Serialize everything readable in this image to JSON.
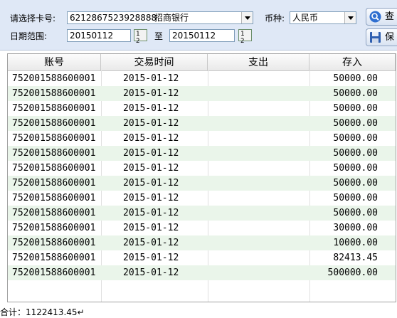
{
  "filter": {
    "card_label": "请选择卡号:",
    "card_number": "6212867523928888",
    "bank_name": "招商银行",
    "currency_label": "币种:",
    "currency_value": "人民币",
    "date_label": "日期范围:",
    "date_from": "20150112",
    "date_to_label": "至",
    "date_to": "20150112",
    "calendar_icon_text": "1 2"
  },
  "toolbar": {
    "query_label": "查",
    "save_label": "保"
  },
  "table": {
    "columns": [
      "账号",
      "交易时间",
      "支出",
      "存入"
    ],
    "rows": [
      {
        "account": "752001588600001",
        "time": "2015-01-12",
        "out": "",
        "in": "50000.00"
      },
      {
        "account": "752001588600001",
        "time": "2015-01-12",
        "out": "",
        "in": "50000.00"
      },
      {
        "account": "752001588600001",
        "time": "2015-01-12",
        "out": "",
        "in": "50000.00"
      },
      {
        "account": "752001588600001",
        "time": "2015-01-12",
        "out": "",
        "in": "50000.00"
      },
      {
        "account": "752001588600001",
        "time": "2015-01-12",
        "out": "",
        "in": "50000.00"
      },
      {
        "account": "752001588600001",
        "time": "2015-01-12",
        "out": "",
        "in": "50000.00"
      },
      {
        "account": "752001588600001",
        "time": "2015-01-12",
        "out": "",
        "in": "50000.00"
      },
      {
        "account": "752001588600001",
        "time": "2015-01-12",
        "out": "",
        "in": "50000.00"
      },
      {
        "account": "752001588600001",
        "time": "2015-01-12",
        "out": "",
        "in": "50000.00"
      },
      {
        "account": "752001588600001",
        "time": "2015-01-12",
        "out": "",
        "in": "50000.00"
      },
      {
        "account": "752001588600001",
        "time": "2015-01-12",
        "out": "",
        "in": "30000.00"
      },
      {
        "account": "752001588600001",
        "time": "2015-01-12",
        "out": "",
        "in": "10000.00"
      },
      {
        "account": "752001588600001",
        "time": "2015-01-12",
        "out": "",
        "in": "82413.45"
      },
      {
        "account": "752001588600001",
        "time": "2015-01-12",
        "out": "",
        "in": "500000.00"
      }
    ]
  },
  "footer": {
    "total_text": "合计：1122413.45↵"
  }
}
